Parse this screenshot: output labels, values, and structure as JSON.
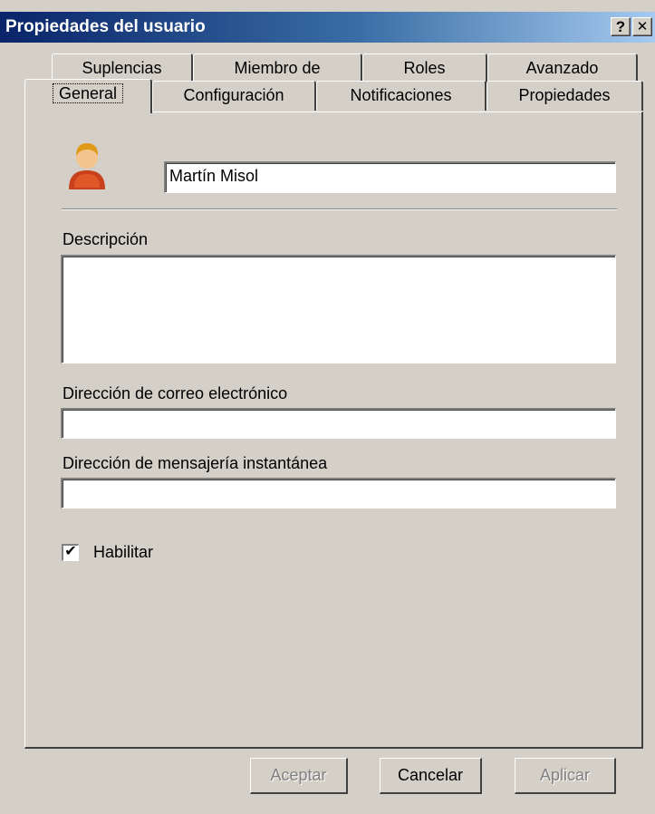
{
  "window": {
    "title": "Propiedades del usuario",
    "help_label": "?",
    "close_label": "✕"
  },
  "tabs": {
    "row1": [
      "Suplencias",
      "Miembro de",
      "Roles",
      "Avanzado"
    ],
    "row2": [
      "General",
      "Configuración",
      "Notificaciones",
      "Propiedades"
    ],
    "active": "General"
  },
  "general": {
    "user_icon": "user-avatar-icon",
    "name_value": "Martín Misol",
    "description_label": "Descripción",
    "description_value": "",
    "email_label": "Dirección de correo electrónico",
    "email_value": "",
    "im_label": "Dirección de mensajería instantánea",
    "im_value": "",
    "enable_label": "Habilitar",
    "enable_checked": true,
    "check_mark": "✔"
  },
  "buttons": {
    "ok": "Aceptar",
    "cancel": "Cancelar",
    "apply": "Aplicar"
  },
  "colors": {
    "title_start": "#0a246a",
    "title_end": "#a6caf0",
    "face": "#d4d0c8"
  }
}
